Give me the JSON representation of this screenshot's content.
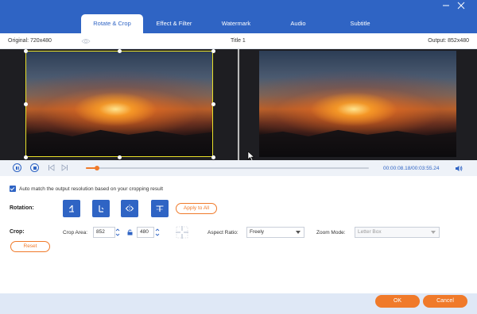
{
  "window": {
    "minimize_icon": "minimize-icon",
    "close_icon": "close-icon"
  },
  "tabs": [
    {
      "label": "Rotate & Crop",
      "active": true
    },
    {
      "label": "Effect & Filter",
      "active": false
    },
    {
      "label": "Watermark",
      "active": false
    },
    {
      "label": "Audio",
      "active": false
    },
    {
      "label": "Subtitle",
      "active": false
    }
  ],
  "info": {
    "original": "Original: 720x480",
    "title": "Title 1",
    "output": "Output: 852x480"
  },
  "playback": {
    "timecode": "00:00:08.18/00:03:55.24",
    "progress": 0.04
  },
  "options": {
    "auto_match_label": "Auto match the output resolution based on your cropping result",
    "auto_match_checked": true
  },
  "rotation": {
    "label": "Rotation:",
    "buttons": [
      "rotate-left-icon",
      "rotate-right-icon",
      "flip-horizontal-icon",
      "flip-vertical-icon"
    ],
    "apply_all": "Apply to All"
  },
  "crop": {
    "label": "Crop:",
    "area_label": "Crop Area:",
    "width": "852",
    "height": "480",
    "aspect_label": "Aspect Ratio:",
    "aspect_value": "Freely",
    "zoom_label": "Zoom Mode:",
    "zoom_value": "Letter Box",
    "reset": "Reset"
  },
  "footer": {
    "ok": "OK",
    "cancel": "Cancel"
  },
  "colors": {
    "accent": "#2f64c4",
    "action": "#f07a2a",
    "crop_border": "#e8e02a"
  }
}
